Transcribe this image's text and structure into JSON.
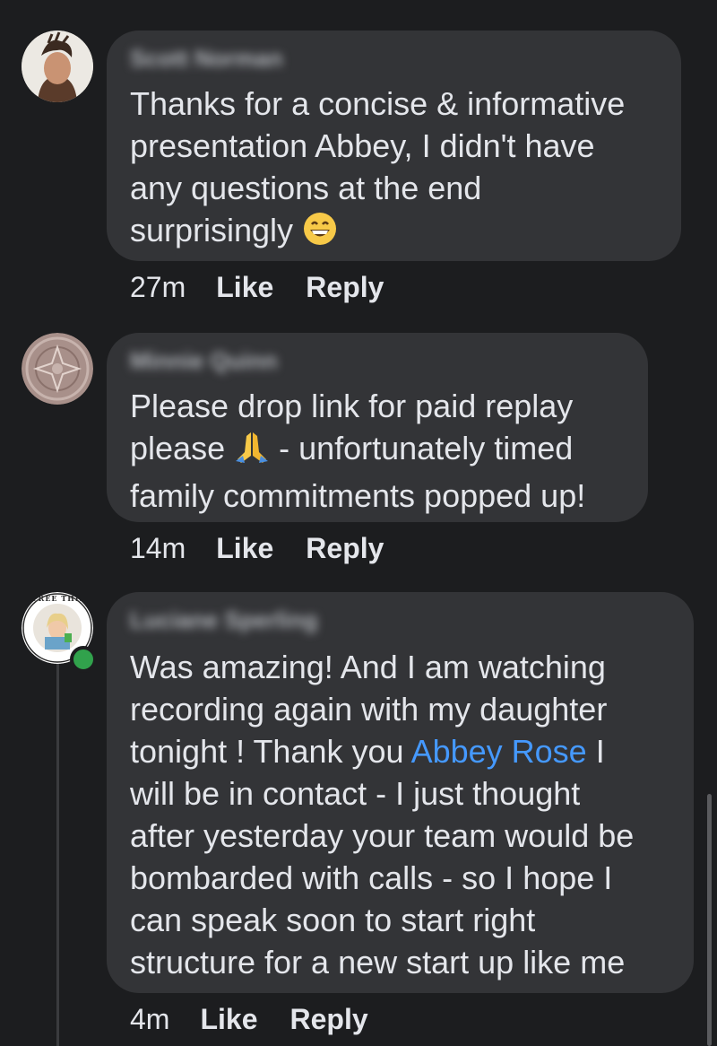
{
  "comments": [
    {
      "author": "Scott Norman",
      "text_before": "Thanks for a concise & informative\npresentation Abbey, I didn't have\nany questions at the end\nsurprisingly ",
      "emoji": "grinning-face-with-smiling-eyes",
      "time": "27m",
      "like_label": "Like",
      "reply_label": "Reply"
    },
    {
      "author": "Minnie Quinn",
      "line1": "Please drop link for paid replay",
      "line2_before": "please ",
      "emoji": "folded-hands",
      "line2_after": " - unfortunately timed",
      "line3": "family commitments popped up!",
      "time": "14m",
      "like_label": "Like",
      "reply_label": "Reply"
    },
    {
      "author": "Luciane Sperling",
      "avatar_ring_text": "FREE THINKER",
      "text_before": "Was amazing! And I am watching\nrecording again with my daughter\ntonight ! Thank you ",
      "mention": "Abbey Rose",
      "text_after": " I\nwill be in contact - I just thought\nafter yesterday your team would be\nbombarded with calls - so I hope I\ncan speak soon to start right\nstructure for a new start up like me",
      "time": "4m",
      "like_label": "Like",
      "reply_label": "Reply",
      "online": true
    }
  ],
  "colors": {
    "background": "#1c1d1f",
    "bubble": "#333437",
    "text": "#e4e6eb",
    "secondary": "#b0b3b8",
    "mention": "#4599ff",
    "online": "#31a24c"
  }
}
